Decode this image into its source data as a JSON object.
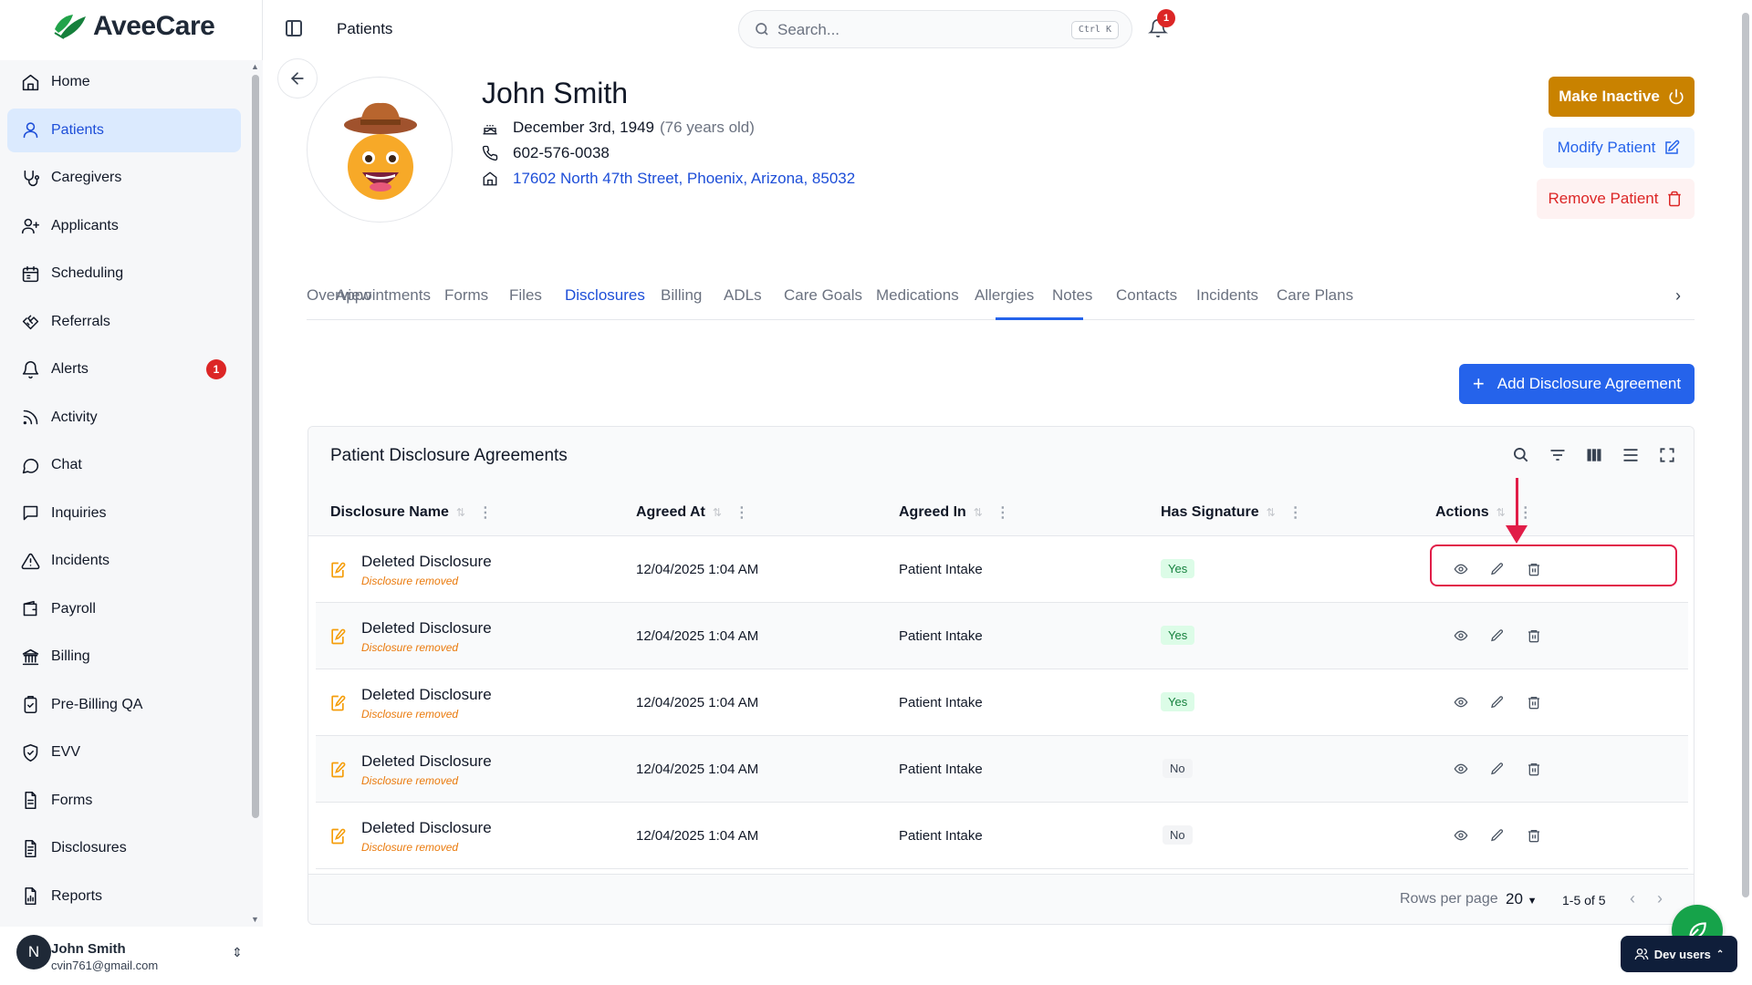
{
  "app": {
    "brand": "AveeCare",
    "brand_color": "#22a34a"
  },
  "sidebar": {
    "items": [
      {
        "label": "Home",
        "icon": "home-icon"
      },
      {
        "label": "Patients",
        "icon": "user-icon",
        "active": true
      },
      {
        "label": "Caregivers",
        "icon": "stethoscope-icon"
      },
      {
        "label": "Applicants",
        "icon": "user-plus-icon"
      },
      {
        "label": "Scheduling",
        "icon": "calendar-icon"
      },
      {
        "label": "Referrals",
        "icon": "handshake-icon"
      },
      {
        "label": "Alerts",
        "icon": "bell-icon",
        "badge": "1"
      },
      {
        "label": "Activity",
        "icon": "rss-icon"
      },
      {
        "label": "Chat",
        "icon": "message-circle-icon"
      },
      {
        "label": "Inquiries",
        "icon": "message-square-icon"
      },
      {
        "label": "Incidents",
        "icon": "alert-triangle-icon"
      },
      {
        "label": "Payroll",
        "icon": "wallet-icon"
      },
      {
        "label": "Billing",
        "icon": "bank-icon"
      },
      {
        "label": "Pre-Billing QA",
        "icon": "clipboard-check-icon"
      },
      {
        "label": "EVV",
        "icon": "shield-check-icon"
      },
      {
        "label": "Forms",
        "icon": "file-text-icon"
      },
      {
        "label": "Disclosures",
        "icon": "file-list-icon"
      },
      {
        "label": "Reports",
        "icon": "file-chart-icon"
      }
    ],
    "user": {
      "initial": "N",
      "name": "John Smith",
      "email": "cvin761@gmail.com"
    }
  },
  "topbar": {
    "breadcrumb": "Patients",
    "search_placeholder": "Search...",
    "search_shortcut": "Ctrl K",
    "notification_count": "1"
  },
  "patient": {
    "name": "John Smith",
    "dob": "December 3rd, 1949",
    "age": "(76 years old)",
    "phone": "602-576-0038",
    "address": "17602 North 47th Street, Phoenix, Arizona, 85032"
  },
  "actions": {
    "make_inactive": "Make Inactive",
    "modify": "Modify Patient",
    "remove": "Remove Patient",
    "add_disclosure": "Add Disclosure Agreement"
  },
  "tabs": [
    "Overview",
    "Appointments",
    "Forms",
    "Files",
    "Disclosures",
    "Billing",
    "ADLs",
    "Care Goals",
    "Medications",
    "Allergies",
    "Notes",
    "Contacts",
    "Incidents",
    "Care Plans"
  ],
  "active_tab": "Disclosures",
  "table": {
    "title": "Patient Disclosure Agreements",
    "columns": [
      "Disclosure Name",
      "Agreed At",
      "Agreed In",
      "Has Signature",
      "Actions"
    ],
    "rows": [
      {
        "name": "Deleted Disclosure",
        "note": "Disclosure removed",
        "agreed_at": "12/04/2025 1:04 AM",
        "agreed_in": "Patient Intake",
        "signature": "Yes"
      },
      {
        "name": "Deleted Disclosure",
        "note": "Disclosure removed",
        "agreed_at": "12/04/2025 1:04 AM",
        "agreed_in": "Patient Intake",
        "signature": "Yes"
      },
      {
        "name": "Deleted Disclosure",
        "note": "Disclosure removed",
        "agreed_at": "12/04/2025 1:04 AM",
        "agreed_in": "Patient Intake",
        "signature": "Yes"
      },
      {
        "name": "Deleted Disclosure",
        "note": "Disclosure removed",
        "agreed_at": "12/04/2025 1:04 AM",
        "agreed_in": "Patient Intake",
        "signature": "No"
      },
      {
        "name": "Deleted Disclosure",
        "note": "Disclosure removed",
        "agreed_at": "12/04/2025 1:04 AM",
        "agreed_in": "Patient Intake",
        "signature": "No"
      }
    ],
    "rows_per_page_label": "Rows per page",
    "rows_per_page": "20",
    "range": "1-5 of 5"
  },
  "floating": {
    "dev_users": "Dev users"
  },
  "colors": {
    "primary": "#2563eb",
    "warning": "#c98200",
    "danger": "#dc2626",
    "highlight": "#e11d48"
  }
}
